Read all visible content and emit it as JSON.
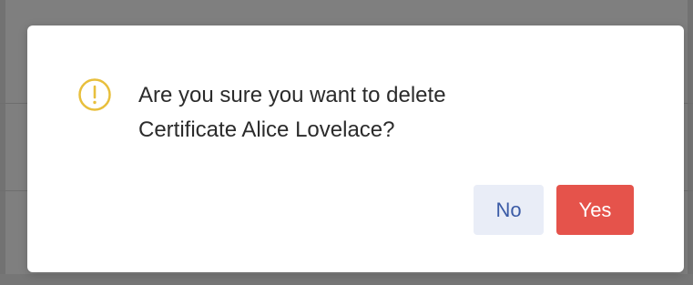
{
  "dialog": {
    "icon": "warning-circle-icon",
    "message_line1": "Are you sure you want to delete",
    "message_line2": "Certificate Alice Lovelace?",
    "no_label": "No",
    "yes_label": "Yes"
  },
  "colors": {
    "warning_icon": "#e8bf3c",
    "no_button_bg": "#e9edf7",
    "no_button_text": "#3b5ba6",
    "yes_button_bg": "#e5534b",
    "yes_button_text": "#ffffff",
    "overlay": "#7f7f7f"
  }
}
